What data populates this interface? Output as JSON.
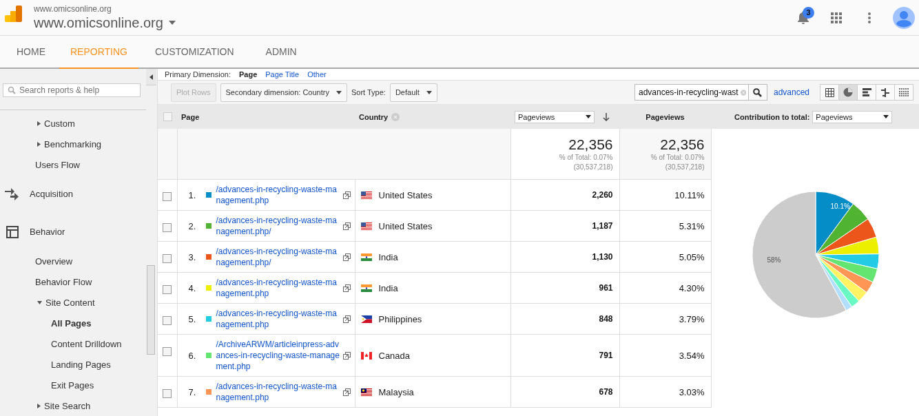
{
  "header": {
    "site_small": "www.omicsonline.org",
    "site": "www.omicsonline.org",
    "notifications": "3"
  },
  "tabs": [
    {
      "label": "HOME",
      "selected": false
    },
    {
      "label": "REPORTING",
      "selected": true
    },
    {
      "label": "CUSTOMIZATION",
      "selected": false
    },
    {
      "label": "ADMIN",
      "selected": false
    }
  ],
  "sidebar": {
    "search_placeholder": "Search reports & help",
    "items": [
      {
        "kind": "link",
        "label": "Custom",
        "expanded": false
      },
      {
        "kind": "link",
        "label": "Benchmarking",
        "expanded": false
      },
      {
        "kind": "link",
        "label": "Users Flow"
      },
      {
        "kind": "section",
        "label": "Acquisition"
      },
      {
        "kind": "section",
        "label": "Behavior"
      },
      {
        "kind": "link",
        "label": "Overview"
      },
      {
        "kind": "link",
        "label": "Behavior Flow"
      },
      {
        "kind": "link",
        "label": "Site Content",
        "expanded": true,
        "children": [
          {
            "label": "All Pages",
            "selected": true
          },
          {
            "label": "Content Drilldown",
            "selected": false
          },
          {
            "label": "Landing Pages",
            "selected": false
          },
          {
            "label": "Exit Pages",
            "selected": false
          }
        ]
      },
      {
        "kind": "link",
        "label": "Site Search",
        "expanded": false
      }
    ]
  },
  "primary_dimension": {
    "label": "Primary Dimension:",
    "options": [
      {
        "label": "Page",
        "selected": true
      },
      {
        "label": "Page Title",
        "selected": false
      },
      {
        "label": "Other",
        "selected": false
      }
    ]
  },
  "toolbar": {
    "plot_rows": "Plot Rows",
    "plot_rows_disabled": true,
    "secondary": "Secondary dimension: Country",
    "sort_label": "Sort Type:",
    "sort": "Default",
    "search": "advances-in-recycling-wast",
    "advanced": "advanced",
    "views": [
      {
        "selected": false
      },
      {
        "selected": true
      },
      {
        "selected": false
      },
      {
        "selected": false
      },
      {
        "selected": false
      }
    ]
  },
  "table": {
    "header_checked": false,
    "columns": {
      "page": "Page",
      "country": "Country",
      "metric_select": "Pageviews",
      "metric": "Pageviews",
      "contribution_label": "Contribution to total:",
      "contribution_select": "Pageviews"
    },
    "totals": [
      {
        "value": "22,356",
        "pct": "% of Total: 0.07%",
        "total": "(30,537,218)"
      },
      {
        "value": "22,356",
        "pct": "% of Total: 0.07%",
        "total": "(30,537,218)"
      }
    ],
    "rows": [
      {
        "checked": false,
        "index": "1.",
        "color": "#058dc7",
        "page": "/advances-in-recycling-waste-management.php",
        "country": "United States",
        "pageviews": "2,260",
        "share": "10.11%"
      },
      {
        "checked": false,
        "index": "2.",
        "color": "#50b432",
        "page": "/advances-in-recycling-waste-management.php/",
        "country": "United States",
        "pageviews": "1,187",
        "share": "5.31%"
      },
      {
        "checked": false,
        "index": "3.",
        "color": "#ed561b",
        "page": "/advances-in-recycling-waste-management.php/",
        "country": "India",
        "pageviews": "1,130",
        "share": "5.05%"
      },
      {
        "checked": false,
        "index": "4.",
        "color": "#edef00",
        "page": "/advances-in-recycling-waste-management.php",
        "country": "India",
        "pageviews": "961",
        "share": "4.30%"
      },
      {
        "checked": false,
        "index": "5.",
        "color": "#24cbe5",
        "page": "/advances-in-recycling-waste-management.php",
        "country": "Philippines",
        "pageviews": "848",
        "share": "3.79%"
      },
      {
        "checked": false,
        "index": "6.",
        "color": "#64e572",
        "page": "/ArchiveARWM/articleinpress-advances-in-recycling-waste-management.php",
        "country": "Canada",
        "pageviews": "791",
        "share": "3.54%"
      },
      {
        "checked": false,
        "index": "7.",
        "color": "#ff9655",
        "page": "/advances-in-recycling-waste-management.php",
        "country": "Malaysia",
        "pageviews": "678",
        "share": "3.03%"
      }
    ],
    "pie_labels": [
      "10.1%",
      "58%"
    ]
  }
}
